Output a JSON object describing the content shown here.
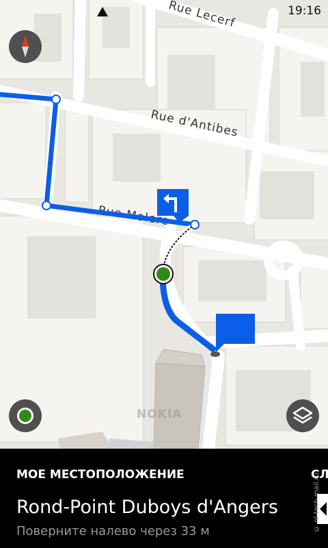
{
  "status_bar": {
    "time": "19:16",
    "signal_icon": "signal-icon"
  },
  "map": {
    "streets": [
      {
        "name": "Rue Lecerf"
      },
      {
        "name": "Rue d'Antibes"
      },
      {
        "name": "Rue Molere"
      }
    ],
    "watermark": "NOKIA",
    "route_color": "#0b5ee8",
    "current_position_color": "#2e8b16",
    "turn_sign_icon": "turn-left-icon",
    "destination_flag_icon": "flag-icon"
  },
  "controls": {
    "compass_icon": "compass-icon",
    "my_location_icon": "my-location-icon",
    "layers_icon": "layers-icon"
  },
  "panel": {
    "heading": "МОЕ МЕСТОПОЛОЖЕНИЕ",
    "street": "Rond-Point Duboys d'Angers",
    "instruction": "Поверните налево через 33 м",
    "next_peek": "СЛ",
    "site_credit": "© nl-tech.mail.ru"
  }
}
